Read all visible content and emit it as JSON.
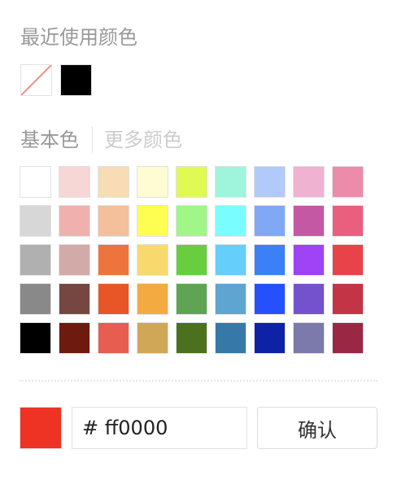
{
  "recent": {
    "title": "最近使用颜色",
    "colors": [
      "none",
      "#000000"
    ]
  },
  "tabs": {
    "basic": "基本色",
    "more": "更多颜色"
  },
  "palette": [
    [
      "#ffffff",
      "#f7d6d6",
      "#f7dcb5",
      "#fffbd2",
      "#e0f953",
      "#9ff5dc",
      "#b1caf9",
      "#efb2d1",
      "#ec8caa"
    ],
    [
      "#d7d7d7",
      "#f0b1ae",
      "#f4bf9b",
      "#fefd52",
      "#a0f686",
      "#7afdfe",
      "#81a8f5",
      "#c458a5",
      "#ea5f7d"
    ],
    [
      "#b0b0b0",
      "#d2aaa8",
      "#ed743c",
      "#f8d96e",
      "#68cd3f",
      "#66cefa",
      "#3b80f6",
      "#9e43f6",
      "#e84349"
    ],
    [
      "#898989",
      "#754740",
      "#e85627",
      "#f3aa41",
      "#5ea452",
      "#5ea5d2",
      "#2451fb",
      "#7452cd",
      "#c33446"
    ],
    [
      "#000000",
      "#6f1a0e",
      "#e75d50",
      "#cfa756",
      "#4b711f",
      "#3678a8",
      "#0e22a6",
      "#7b7aaa",
      "#9a2743"
    ]
  ],
  "current": {
    "color": "#ee3224",
    "hex_value": "# ff0000"
  },
  "confirm_label": "确认"
}
